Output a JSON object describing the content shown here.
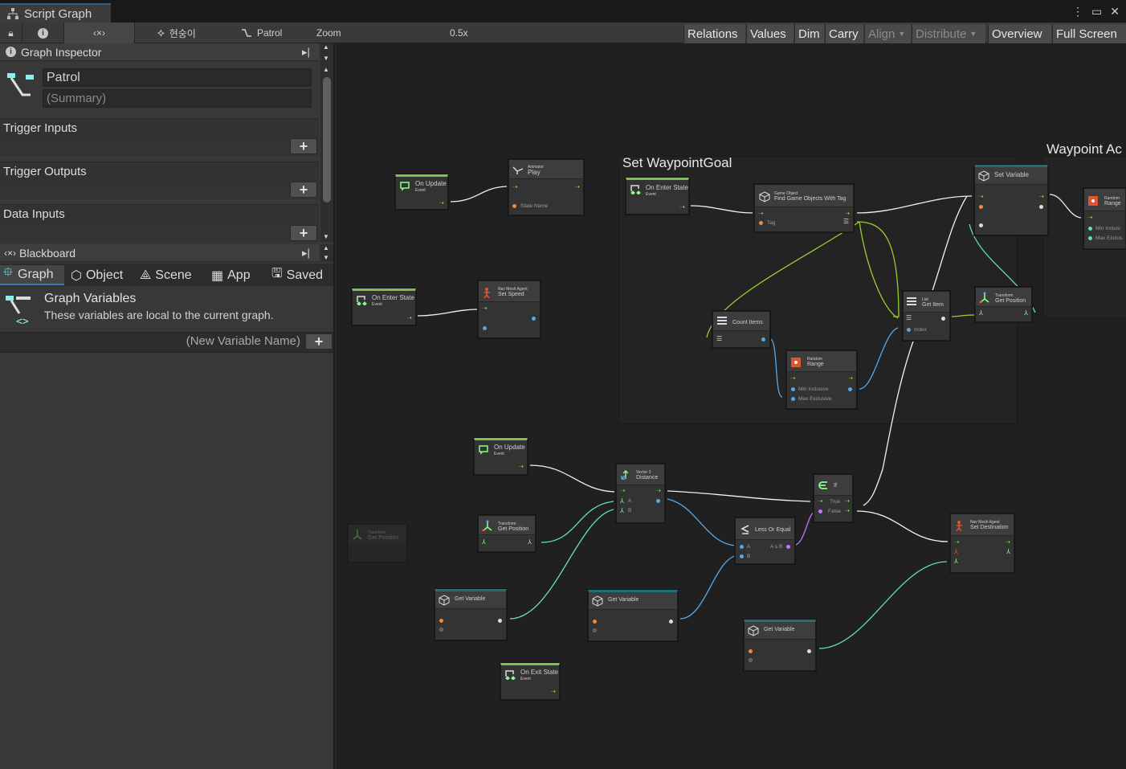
{
  "window": {
    "tab_title": "Script Graph"
  },
  "toolbar": {
    "state_graph_label": "현숭이",
    "patrol_label": "Patrol",
    "zoom_label": "Zoom",
    "zoom_value": "0.5x",
    "zoom_fraction": 0.22,
    "buttons": [
      "Relations",
      "Values",
      "Dim",
      "Carry",
      "Align",
      "Distribute",
      "Overview",
      "Full Screen"
    ]
  },
  "inspector": {
    "header": "Graph Inspector",
    "graph_title": "Patrol",
    "summary_placeholder": "(Summary)",
    "trigger_inputs": "Trigger Inputs",
    "trigger_outputs": "Trigger Outputs",
    "data_inputs": "Data Inputs"
  },
  "blackboard": {
    "header": "Blackboard",
    "tabs": [
      "Graph",
      "Object",
      "Scene",
      "App",
      "Saved"
    ],
    "vars_title": "Graph Variables",
    "vars_desc": "These variables are local to the current graph.",
    "new_var_placeholder": "(New Variable Name)"
  },
  "groups": {
    "set_waypoint": "Set WaypointGoal",
    "waypoint_partial": "Waypoint Ac"
  },
  "nodes": {
    "on_update_1": {
      "title": "On Update",
      "sub": "Event"
    },
    "animator_play": {
      "sub": "Animator",
      "title": "Play",
      "state_label": "State Name"
    },
    "on_enter_1": {
      "title": "On Enter State",
      "sub": "Event"
    },
    "find_tag": {
      "sub": "Game Object",
      "title": "Find Game Objects With Tag",
      "tag_label": "Tag"
    },
    "set_variable": {
      "title": "Set Variable"
    },
    "random_range_r": {
      "sub": "Random",
      "title": "Range",
      "min": "Min Inclusi",
      "max": "Max Exclus"
    },
    "on_enter_2": {
      "title": "On Enter State",
      "sub": "Event"
    },
    "nav_speed": {
      "sub": "Nav Mesh Agent",
      "title": "Set Speed"
    },
    "count_items": {
      "title": "Count Items"
    },
    "list_get": {
      "sub": "List",
      "title": "Get Item",
      "index": "Index"
    },
    "transform_pos_1": {
      "sub": "Transform",
      "title": "Get Position"
    },
    "random_range": {
      "sub": "Random",
      "title": "Range",
      "min": "Min Inclusive",
      "max": "Max Exclusive"
    },
    "on_update_2": {
      "title": "On Update",
      "sub": "Event"
    },
    "vector_distance": {
      "sub": "Vector 3",
      "title": "Distance",
      "a": "A",
      "b": "B"
    },
    "if": {
      "title": "If",
      "true": "True",
      "false": "False"
    },
    "transform_pos_faded": {
      "sub": "Transform",
      "title": "Get Position"
    },
    "transform_pos_2": {
      "sub": "Transform",
      "title": "Get Position"
    },
    "less_equal": {
      "title": "Less Or Equal",
      "a": "A",
      "b": "B",
      "out": "A ≤ B"
    },
    "nav_dest": {
      "sub": "Nav Mesh Agent",
      "title": "Set Destination"
    },
    "get_var_1": {
      "title": "Get Variable"
    },
    "get_var_2": {
      "title": "Get Variable"
    },
    "get_var_3": {
      "title": "Get Variable"
    },
    "on_exit": {
      "title": "On Exit State",
      "sub": "Event"
    }
  }
}
